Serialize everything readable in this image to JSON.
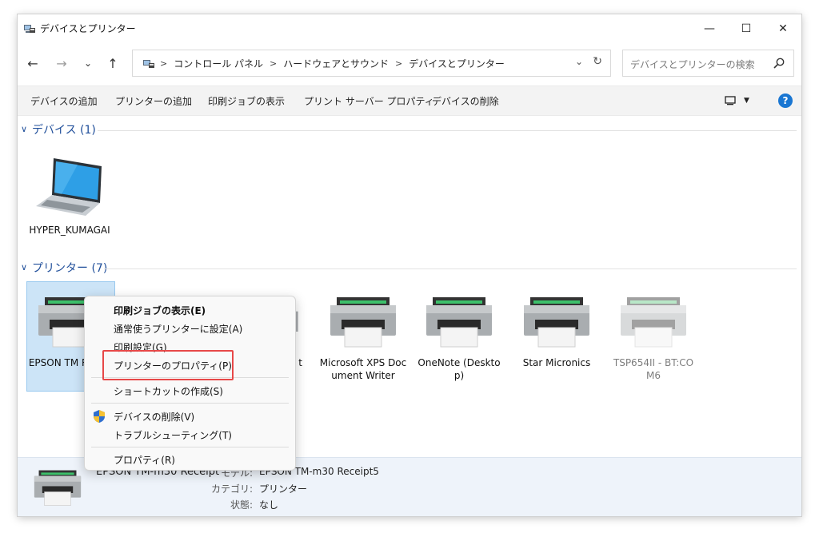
{
  "window": {
    "title": "デバイスとプリンター",
    "controls": {
      "minimize": "—",
      "maximize": "☐",
      "close": "✕"
    }
  },
  "nav": {
    "back": "←",
    "forward": "→",
    "recent": "⌄",
    "up": "↑"
  },
  "address": {
    "crumbs": [
      "コントロール パネル",
      "ハードウェアとサウンド",
      "デバイスとプリンター"
    ],
    "separator": ">"
  },
  "search": {
    "placeholder": "デバイスとプリンターの検索"
  },
  "commands": [
    "デバイスの追加",
    "プリンターの追加",
    "印刷ジョブの表示",
    "プリント サーバー プロパティ",
    "デバイスの削除"
  ],
  "help": "?",
  "sections": {
    "devices": {
      "label": "デバイス (1)"
    },
    "printers": {
      "label": "プリンター (7)"
    }
  },
  "devices": [
    {
      "label": "HYPER_KUMAGAI"
    }
  ],
  "printers": [
    {
      "label": "EPSON TM Receip"
    },
    {
      "label": "t"
    },
    {
      "label": "Microsoft XPS Document Writer"
    },
    {
      "label": "OneNote (Desktop)"
    },
    {
      "label": "Star Micronics"
    },
    {
      "label": "TSP654II - BT:COM6"
    }
  ],
  "context_menu": {
    "items": [
      "印刷ジョブの表示(E)",
      "通常使うプリンターに設定(A)",
      "印刷設定(G)",
      "プリンターのプロパティ(P)",
      "ショートカットの作成(S)",
      "デバイスの削除(V)",
      "トラブルシューティング(T)",
      "プロパティ(R)"
    ]
  },
  "details": {
    "name": "EPSON TM-m30 Receipt",
    "model_value": "EPSON TM-m30 Receipt5",
    "model_label": "モデル:",
    "category_label": "カテゴリ:",
    "category_value": "プリンター",
    "status_label": "状態:",
    "status_value": "なし"
  }
}
